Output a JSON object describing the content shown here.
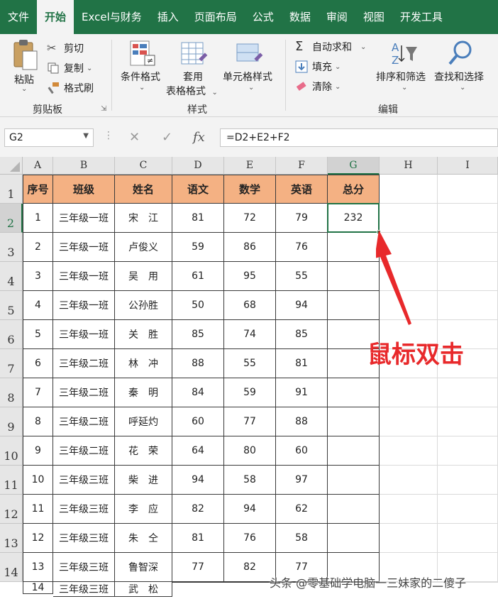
{
  "menu": {
    "items": [
      "文件",
      "开始",
      "Excel与财务",
      "插入",
      "页面布局",
      "公式",
      "数据",
      "审阅",
      "视图",
      "开发工具"
    ],
    "active_index": 1
  },
  "ribbon": {
    "clipboard": {
      "paste": "粘贴",
      "cut": "剪切",
      "copy": "复制",
      "format_painter": "格式刷",
      "group_label": "剪贴板"
    },
    "styles": {
      "conditional_format": "条件格式",
      "table_format_line1": "套用",
      "table_format_line2": "表格格式",
      "cell_styles": "单元格样式",
      "group_label": "样式"
    },
    "editing": {
      "autosum": "自动求和",
      "fill": "填充",
      "clear": "清除",
      "sort_filter": "排序和筛选",
      "find_select": "查找和选择",
      "group_label": "编辑"
    }
  },
  "formula_bar": {
    "name_box": "G2",
    "formula": "=D2+E2+F2",
    "fx": "fx"
  },
  "columns": [
    "A",
    "B",
    "C",
    "D",
    "E",
    "F",
    "G",
    "H",
    "I"
  ],
  "row_numbers": [
    "1",
    "2",
    "3",
    "4",
    "5",
    "6",
    "7",
    "8",
    "9",
    "10",
    "11",
    "12",
    "13",
    "14"
  ],
  "table": {
    "headers": [
      "序号",
      "班级",
      "姓名",
      "语文",
      "数学",
      "英语",
      "总分"
    ],
    "rows": [
      [
        "1",
        "三年级一班",
        "宋　江",
        "81",
        "72",
        "79",
        "232"
      ],
      [
        "2",
        "三年级一班",
        "卢俊义",
        "59",
        "86",
        "76",
        ""
      ],
      [
        "3",
        "三年级一班",
        "吴　用",
        "61",
        "95",
        "55",
        ""
      ],
      [
        "4",
        "三年级一班",
        "公孙胜",
        "50",
        "68",
        "94",
        ""
      ],
      [
        "5",
        "三年级一班",
        "关　胜",
        "85",
        "74",
        "85",
        ""
      ],
      [
        "6",
        "三年级二班",
        "林　冲",
        "88",
        "55",
        "81",
        ""
      ],
      [
        "7",
        "三年级二班",
        "秦　明",
        "84",
        "59",
        "91",
        ""
      ],
      [
        "8",
        "三年级二班",
        "呼延灼",
        "60",
        "77",
        "88",
        ""
      ],
      [
        "9",
        "三年级二班",
        "花　荣",
        "64",
        "80",
        "60",
        ""
      ],
      [
        "10",
        "三年级三班",
        "柴　进",
        "94",
        "58",
        "97",
        ""
      ],
      [
        "11",
        "三年级三班",
        "李　应",
        "82",
        "94",
        "62",
        ""
      ],
      [
        "12",
        "三年级三班",
        "朱　仝",
        "81",
        "76",
        "58",
        ""
      ],
      [
        "13",
        "三年级三班",
        "鲁智深",
        "77",
        "82",
        "77",
        ""
      ],
      [
        "14",
        "三年级三班",
        "武　松",
        "",
        "",
        "",
        ""
      ]
    ]
  },
  "annotation": {
    "text": "鼠标双击",
    "color": "#e8292b"
  },
  "watermark": "头条 @零基础学电脑一三妹家的二傻子",
  "colors": {
    "ribbon_green": "#217346",
    "header_fill": "#f4b183",
    "arrow_red": "#e8292b"
  }
}
